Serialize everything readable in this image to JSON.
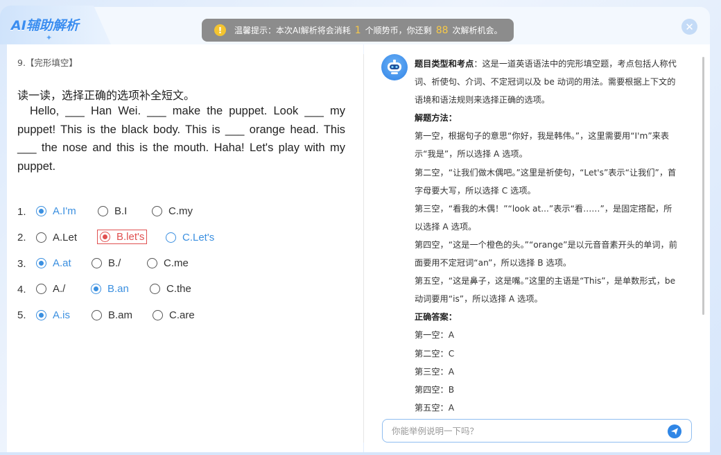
{
  "header": {
    "title": "AI辅助解析",
    "tip": {
      "prefix": "温馨提示：本次AI解析将会消耗",
      "cost": "1",
      "middle": "个顺势币，你还剩",
      "remaining": "88",
      "suffix": "次解析机会。"
    },
    "close_symbol": "✕"
  },
  "question": {
    "number": "9.【完形填空】",
    "instruction": "读一读，选择正确的选项补全短文。",
    "passage": "Hello, ___ Han Wei. ___ make the puppet. Look ___ my puppet! This is the black body. This is ___ orange head. This ___ the nose and this is the mouth. Haha! Let's play with my puppet.",
    "rows": [
      {
        "num": "1.",
        "options": [
          "A.I'm",
          "B.I",
          "C.my"
        ]
      },
      {
        "num": "2.",
        "options": [
          "A.Let",
          "B.let's",
          "C.Let's"
        ]
      },
      {
        "num": "3.",
        "options": [
          "A.at",
          "B./",
          "C.me"
        ]
      },
      {
        "num": "4.",
        "options": [
          "A./",
          "B.an",
          "C.the"
        ]
      },
      {
        "num": "5.",
        "options": [
          "A.is",
          "B.am",
          "C.are"
        ]
      }
    ]
  },
  "analysis": {
    "h1": "题目类型和考点",
    "p1": "：这是一道英语语法中的完形填空题，考点包括人称代词、祈使句、介词、不定冠词以及 be 动词的用法。需要根据上下文的语境和语法规则来选择正确的选项。",
    "h2": "解题方法",
    "s1": "第一空，根据句子的意思“你好，我是韩伟。”，这里需要用“I'm”来表示“我是”，所以选择 A 选项。",
    "s2": "第二空，“让我们做木偶吧。”这里是祈使句，“Let's”表示“让我们”，首字母要大写，所以选择 C 选项。",
    "s3": "第三空，“看我的木偶！”“look at...”表示“看……”，是固定搭配，所以选择 A 选项。",
    "s4": "第四空，“这是一个橙色的头。”“orange”是以元音音素开头的单词，前面要用不定冠词“an”，所以选择 B 选项。",
    "s5": "第五空，“这是鼻子，这是嘴。”这里的主语是“This”，是单数形式，be 动词要用“is”，所以选择 A 选项。",
    "h3": "正确答案",
    "answers": [
      "第一空：A",
      "第二空：C",
      "第三空：A",
      "第四空：B",
      "第五空：A"
    ]
  },
  "ask": {
    "placeholder": "你能举例说明一下吗？"
  },
  "colors": {
    "accent": "#3a8fe0",
    "wrong": "#e05050",
    "tip_bg": "#8c8c8c",
    "tip_number": "#f7c948"
  }
}
